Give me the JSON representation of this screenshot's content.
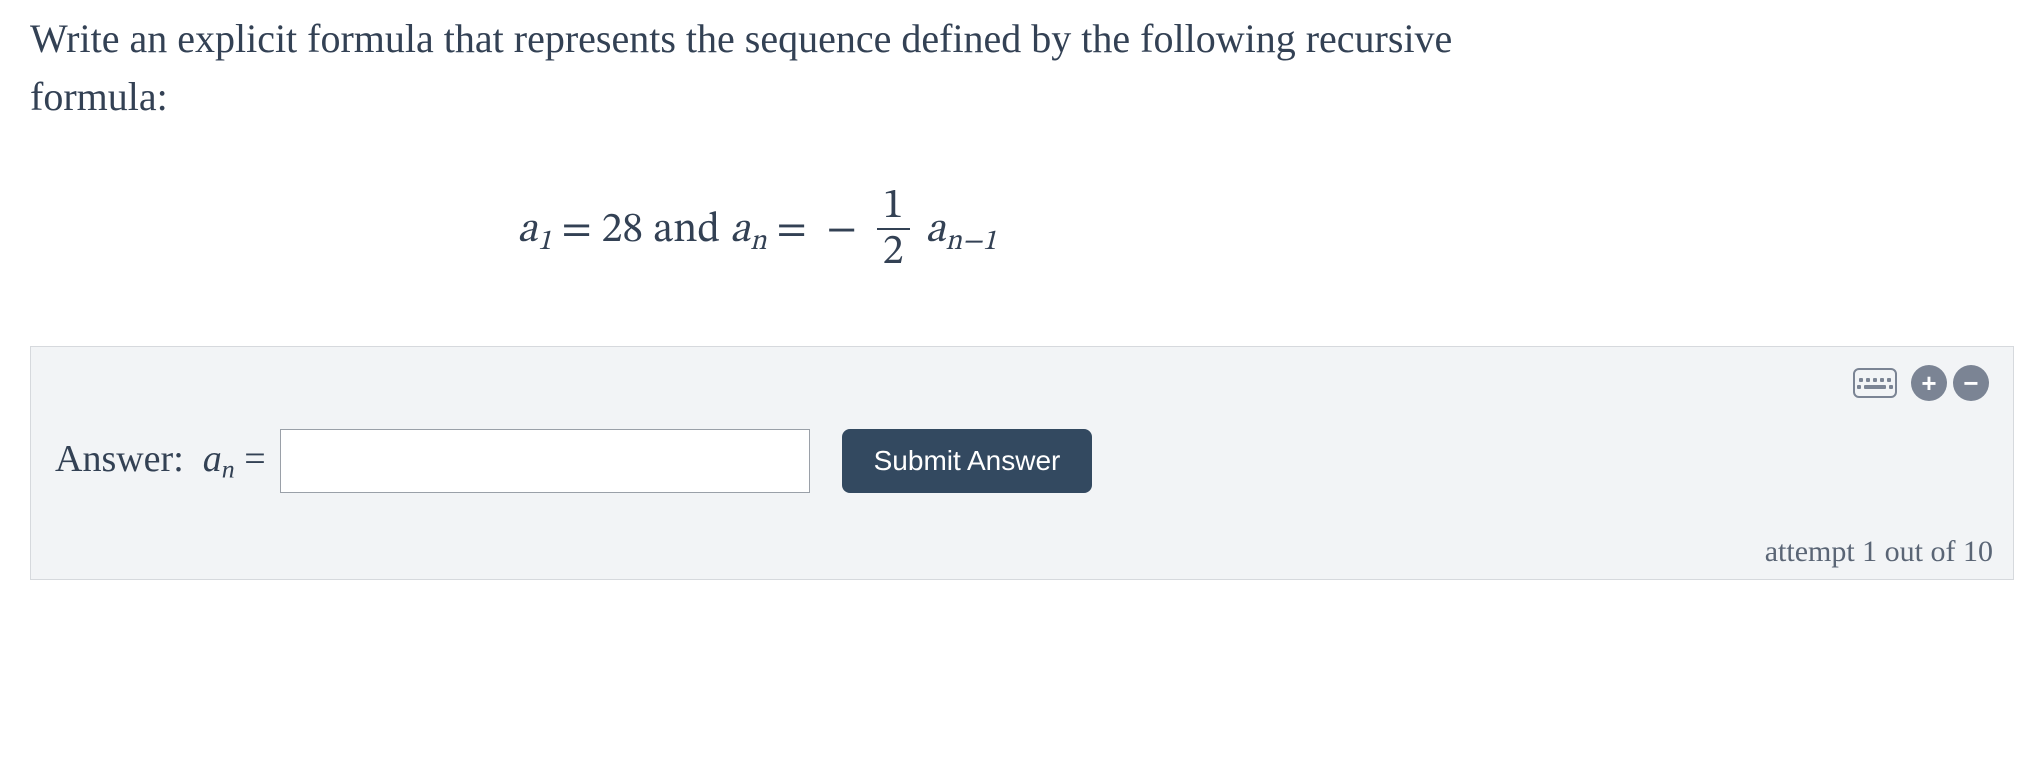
{
  "question": "Write an explicit formula that represents the sequence defined by the following recursive formula:",
  "formula": {
    "a1_value": "28",
    "and_text": "and",
    "frac_num": "1",
    "frac_den": "2"
  },
  "answer": {
    "label_prefix": "Answer:",
    "value": "",
    "placeholder": ""
  },
  "submit_label": "Submit Answer",
  "attempt_text": "attempt 1 out of 10",
  "icons": {
    "keyboard": "keyboard-icon",
    "plus": "+",
    "minus": "−"
  }
}
